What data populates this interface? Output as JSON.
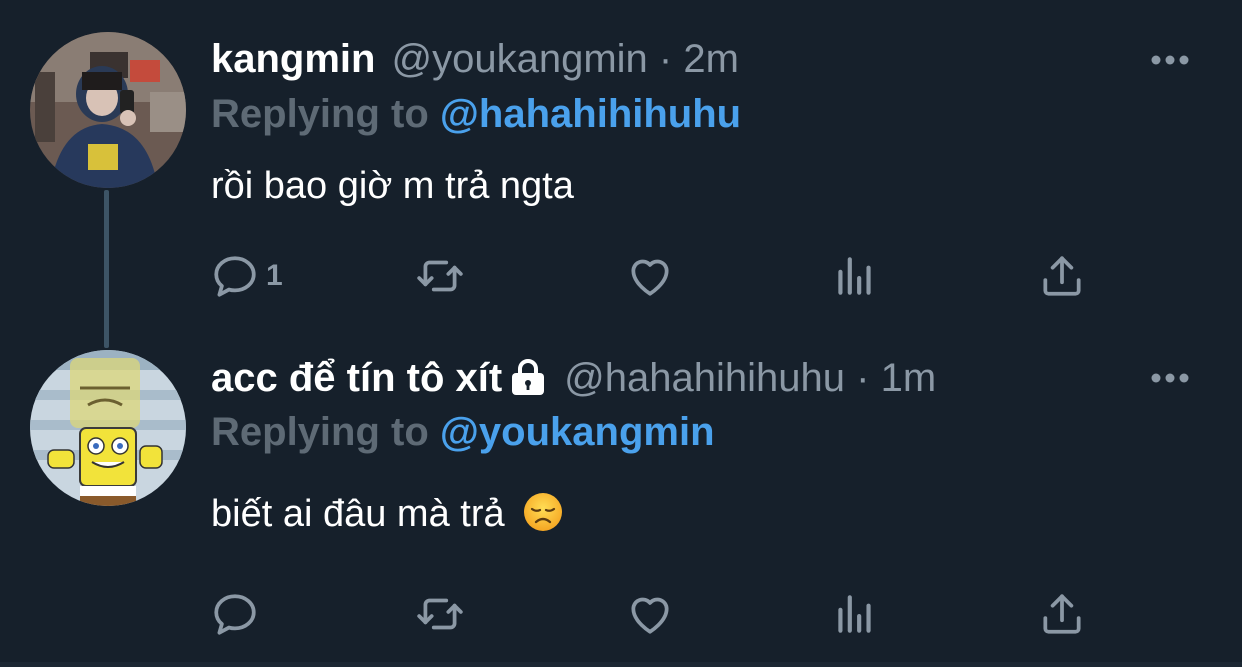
{
  "colors": {
    "background": "#16202b",
    "name": "#ffffff",
    "secondary_text": "#8b98a5",
    "replying_label": "#5e6a75",
    "mention": "#4aa1ec",
    "thread_line": "#3d5466"
  },
  "tweets": [
    {
      "display_name": "kangmin",
      "handle": "@youkangmin",
      "separator": "·",
      "time": "2m",
      "protected": false,
      "replying_label": "Replying to",
      "replying_to": "@hahahihihuhu",
      "text": "rồi bao giờ m trả ngta",
      "emoji": "",
      "reply_count": "1",
      "icons": [
        "reply-icon",
        "retweet-icon",
        "like-icon",
        "analytics-icon",
        "share-icon",
        "more-icon"
      ]
    },
    {
      "display_name": "acc để tín tô xít",
      "handle": "@hahahihihuhu",
      "separator": "·",
      "time": "1m",
      "protected": true,
      "replying_label": "Replying to",
      "replying_to": "@youkangmin",
      "text": "biết ai đâu mà trả",
      "emoji": "disappointed-face-emoji",
      "reply_count": "",
      "icons": [
        "reply-icon",
        "retweet-icon",
        "like-icon",
        "analytics-icon",
        "share-icon",
        "more-icon"
      ]
    }
  ]
}
